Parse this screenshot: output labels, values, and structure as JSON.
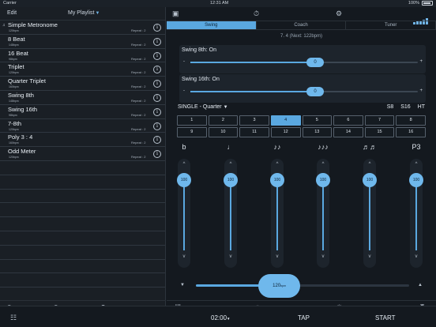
{
  "status": {
    "carrier": "Carrier",
    "time": "12:31 AM",
    "battery": "100%"
  },
  "left": {
    "edit_label": "Edit",
    "playlist_label": "My Playlist",
    "items": [
      {
        "name": "Simple Metronome",
        "bpm": "120bpm",
        "repeat": "Repeat : 2"
      },
      {
        "name": "8 Beat",
        "bpm": "148bpm",
        "repeat": "Repeat : 2"
      },
      {
        "name": "16 Beat",
        "bpm": "98bpm",
        "repeat": "Repeat : 2"
      },
      {
        "name": "Triplet",
        "bpm": "120bpm",
        "repeat": "Repeat : 2"
      },
      {
        "name": "Quarter Triplet",
        "bpm": "160bpm",
        "repeat": "Repeat : 2"
      },
      {
        "name": "Swing 8th",
        "bpm": "148bpm",
        "repeat": "Repeat : 2"
      },
      {
        "name": "Swing 16th",
        "bpm": "98bpm",
        "repeat": "Repeat : 2"
      },
      {
        "name": "7-8th",
        "bpm": "120bpm",
        "repeat": "Repeat : 2"
      },
      {
        "name": "Poly 3 : 4",
        "bpm": "160bpm",
        "repeat": "Repeat : 2"
      },
      {
        "name": "Odd Meter",
        "bpm": "120bpm",
        "repeat": "Repeat : 2"
      }
    ]
  },
  "right": {
    "tabs": [
      "Swing",
      "Coach",
      "Tuner"
    ],
    "position_text": "7. 4 (Next: 122bpm)",
    "swing8": {
      "label": "Swing 8th: On",
      "value": "0",
      "level": 0.5
    },
    "swing16": {
      "label": "Swing 16th: On",
      "value": "0",
      "level": 0.5
    },
    "mode_label": "SINGLE - Quarter",
    "subdiv": [
      "S8",
      "S16",
      "HT"
    ],
    "beats": [
      "1",
      "2",
      "3",
      "4",
      "5",
      "6",
      "7",
      "8",
      "9",
      "10",
      "11",
      "12",
      "13",
      "14",
      "15",
      "16"
    ],
    "active_beat": "4",
    "volumes": [
      {
        "icon": "b",
        "value": "100"
      },
      {
        "icon": "♩",
        "value": "100"
      },
      {
        "icon": "♪♪",
        "value": "100"
      },
      {
        "icon": "♪♪♪",
        "value": "100"
      },
      {
        "icon": "♬♬",
        "value": "100"
      },
      {
        "icon": "P3",
        "value": "100"
      }
    ],
    "tempo_value": "120",
    "tempo_unit": "bpm",
    "tempo_level": 0.33
  },
  "footer": {
    "timer": "02:00",
    "tap": "TAP",
    "start": "START"
  },
  "colors": {
    "accent": "#5aa8e0",
    "background": "#14191f"
  }
}
